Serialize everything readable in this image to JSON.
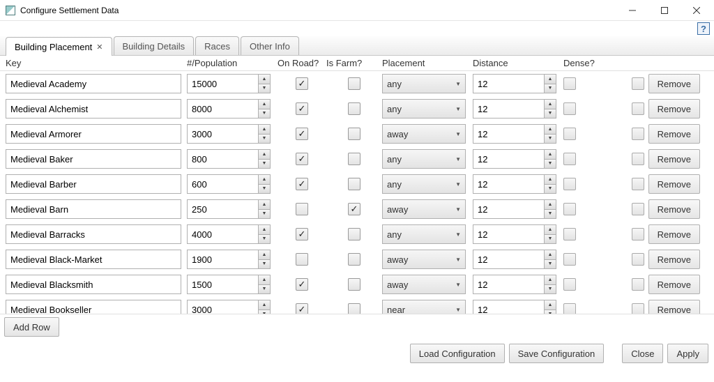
{
  "window": {
    "title": "Configure Settlement Data"
  },
  "help": {
    "label": "?"
  },
  "tabs": [
    {
      "label": "Building Placement",
      "closable": true,
      "active": true
    },
    {
      "label": "Building Details",
      "closable": false,
      "active": false
    },
    {
      "label": "Races",
      "closable": false,
      "active": false
    },
    {
      "label": "Other Info",
      "closable": false,
      "active": false
    }
  ],
  "columns": {
    "key": "Key",
    "pop": "#/Population",
    "road": "On Road?",
    "farm": "Is Farm?",
    "placement": "Placement",
    "distance": "Distance",
    "dense": "Dense?",
    "remove": "Remove"
  },
  "rows": [
    {
      "key": "Medieval Academy",
      "pop": "15000",
      "road": true,
      "farm": false,
      "placement": "any",
      "distance": "12",
      "dense": false
    },
    {
      "key": "Medieval Alchemist",
      "pop": "8000",
      "road": true,
      "farm": false,
      "placement": "any",
      "distance": "12",
      "dense": false
    },
    {
      "key": "Medieval Armorer",
      "pop": "3000",
      "road": true,
      "farm": false,
      "placement": "away",
      "distance": "12",
      "dense": false
    },
    {
      "key": "Medieval Baker",
      "pop": "800",
      "road": true,
      "farm": false,
      "placement": "any",
      "distance": "12",
      "dense": false
    },
    {
      "key": "Medieval Barber",
      "pop": "600",
      "road": true,
      "farm": false,
      "placement": "any",
      "distance": "12",
      "dense": false
    },
    {
      "key": "Medieval Barn",
      "pop": "250",
      "road": false,
      "farm": true,
      "placement": "away",
      "distance": "12",
      "dense": false
    },
    {
      "key": "Medieval Barracks",
      "pop": "4000",
      "road": true,
      "farm": false,
      "placement": "any",
      "distance": "12",
      "dense": false
    },
    {
      "key": "Medieval Black-Market",
      "pop": "1900",
      "road": false,
      "farm": false,
      "placement": "away",
      "distance": "12",
      "dense": false
    },
    {
      "key": "Medieval Blacksmith",
      "pop": "1500",
      "road": true,
      "farm": false,
      "placement": "away",
      "distance": "12",
      "dense": false
    },
    {
      "key": "Medieval Bookseller",
      "pop": "3000",
      "road": true,
      "farm": false,
      "placement": "near",
      "distance": "12",
      "dense": false
    }
  ],
  "buttons": {
    "add_row": "Add Row",
    "load": "Load Configuration",
    "save": "Save Configuration",
    "close": "Close",
    "apply": "Apply",
    "remove": "Remove"
  }
}
